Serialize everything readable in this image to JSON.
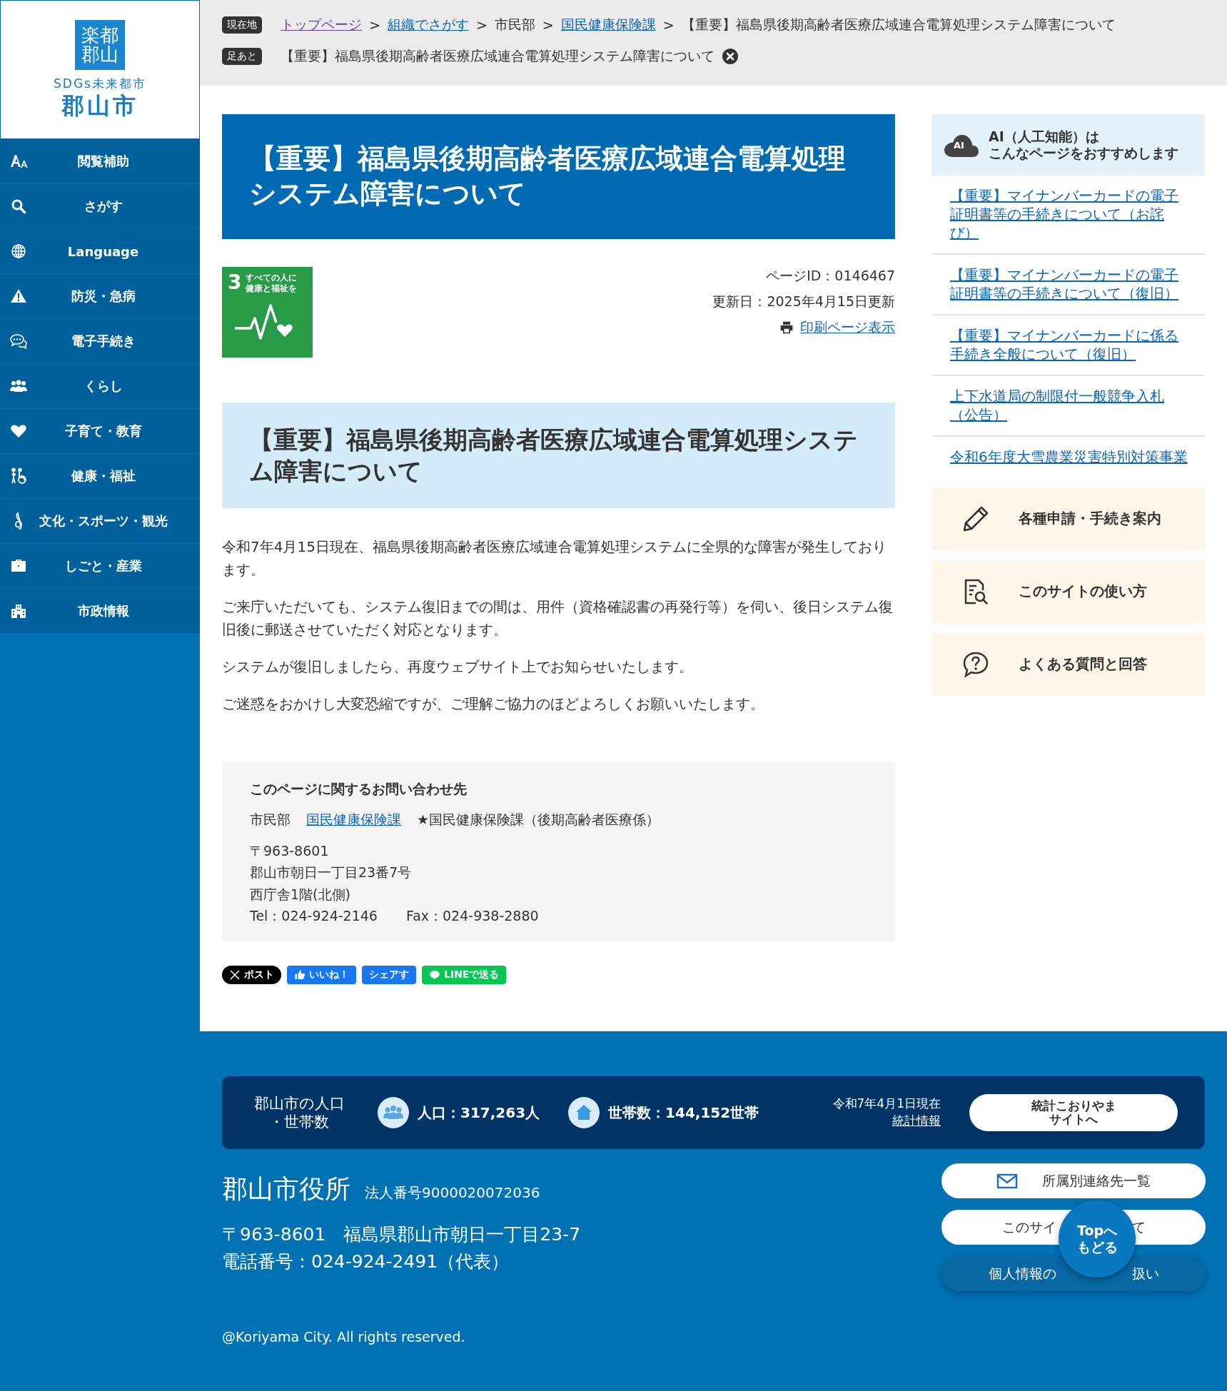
{
  "logo": {
    "emblem": [
      "楽都",
      "郡山"
    ],
    "tagline": "SDGs未来都市",
    "city": "郡山市"
  },
  "sidebar": {
    "items": [
      {
        "label": "閲覧補助",
        "kind": "textsize"
      },
      {
        "label": "さがす",
        "kind": "search"
      },
      {
        "label": "Language",
        "kind": "globe"
      },
      {
        "label": "防災・急病",
        "kind": "warning"
      },
      {
        "label": "電子手続き",
        "kind": "chat"
      },
      {
        "label": "くらし",
        "kind": "people"
      },
      {
        "label": "子育て・教育",
        "kind": "heart"
      },
      {
        "label": "健康・福祉",
        "kind": "wheelchair"
      },
      {
        "label": "文化・スポーツ・観光",
        "kind": "clef"
      },
      {
        "label": "しごと・産業",
        "kind": "briefcase"
      },
      {
        "label": "市政情報",
        "kind": "building"
      }
    ]
  },
  "breadcrumb": {
    "badge": "現在地",
    "items": [
      {
        "kind": "link",
        "text": "トップページ",
        "visited": true
      },
      {
        "kind": "sep",
        "text": ">"
      },
      {
        "kind": "link",
        "text": "組織でさがす",
        "visited": false
      },
      {
        "kind": "sep",
        "text": ">"
      },
      {
        "kind": "plain",
        "text": "市民部"
      },
      {
        "kind": "sep",
        "text": ">"
      },
      {
        "kind": "link",
        "text": "国民健康保険課",
        "visited": false
      },
      {
        "kind": "sep",
        "text": ">"
      },
      {
        "kind": "plain",
        "text": "【重要】福島県後期高齢者医療広域連合電算処理システム障害について"
      }
    ]
  },
  "history": {
    "badge": "足あと",
    "text": "【重要】福島県後期高齢者医療広域連合電算処理システム障害について"
  },
  "title": "【重要】福島県後期高齢者医療広域連合電算処理システム障害について",
  "sdg": {
    "number": "3",
    "caption": [
      "すべての人に",
      "健康と福祉を"
    ]
  },
  "meta": {
    "page_id": "ページID：0146467",
    "updated": "更新日：2025年4月15日更新",
    "print": "印刷ページ表示"
  },
  "heading": "【重要】福島県後期高齢者医療広域連合電算処理システム障害について",
  "paragraphs": [
    "令和7年4月15日現在、福島県後期高齢者医療広域連合電算処理システムに全県的な障害が発生しております。",
    "ご来庁いただいても、システム復旧までの間は、用件（資格確認書の再発行等）を伺い、後日システム復旧後に郵送させていただく対応となります。",
    "システムが復旧しましたら、再度ウェブサイト上でお知らせいたします。",
    "ご迷惑をおかけし大変恐縮ですが、ご理解ご協力のほどよろしくお願いいたします。"
  ],
  "contact": {
    "title": "このページに関するお問い合わせ先",
    "dept": "市民部",
    "link": "国民健康保険課",
    "note": "★国民健康保険課（後期高齢者医療係）",
    "lines": [
      "〒963-8601",
      "郡山市朝日一丁目23番7号",
      "西庁舎1階(北側)"
    ],
    "tel": "Tel：024-924-2146",
    "fax": "Fax：024-938-2880"
  },
  "share": [
    {
      "kind": "x",
      "label": "ポスト"
    },
    {
      "kind": "like",
      "label": "いいね！"
    },
    {
      "kind": "share",
      "label": "シェアす"
    },
    {
      "kind": "line",
      "label": "LINEで送る"
    }
  ],
  "ai": {
    "badge": "AI",
    "title": [
      "AI（人工知能）は",
      "こんなページをおすすめします"
    ],
    "links": [
      "【重要】マイナンバーカードの電子証明書等の手続きについて（お詫び）",
      "【重要】マイナンバーカードの電子証明書等の手続きについて（復旧）",
      "【重要】マイナンバーカードに係る手続き全般について（復旧）",
      "上下水道局の制限付一般競争入札（公告）",
      "令和6年度大雪農業災害特別対策事業"
    ]
  },
  "quick_links": [
    {
      "kind": "pencil",
      "label": "各種申請・手続き案内"
    },
    {
      "kind": "docsearch",
      "label": "このサイトの使い方"
    },
    {
      "kind": "question",
      "label": "よくある質問と回答"
    }
  ],
  "stats": {
    "title": [
      "郡山市の人口",
      "・世帯数"
    ],
    "items": [
      {
        "kind": "people",
        "text": "人口：317,263人"
      },
      {
        "kind": "house",
        "text": "世帯数：144,152世帯"
      }
    ],
    "as_of": "令和7年4月1日現在",
    "link": "統計情報",
    "button": [
      "統計こおりやま",
      "サイトへ"
    ]
  },
  "footer": {
    "name": "郡山市役所",
    "corp": "法人番号9000020072036",
    "address": "〒963-8601　福島県郡山市朝日一丁目23-7",
    "phone": "電話番号：024-924-2491（代表）",
    "copyright": "@Koriyama City. All rights reserved.",
    "buttons": [
      {
        "kind": "mail",
        "start": "所属別連絡先一覧"
      },
      {
        "kind": "plain",
        "start": "このサイ",
        "end": "て"
      },
      {
        "kind": "dark",
        "start": "個人情報の",
        "end": "扱い"
      }
    ],
    "top_button": [
      "Topへ",
      "もどる"
    ]
  }
}
